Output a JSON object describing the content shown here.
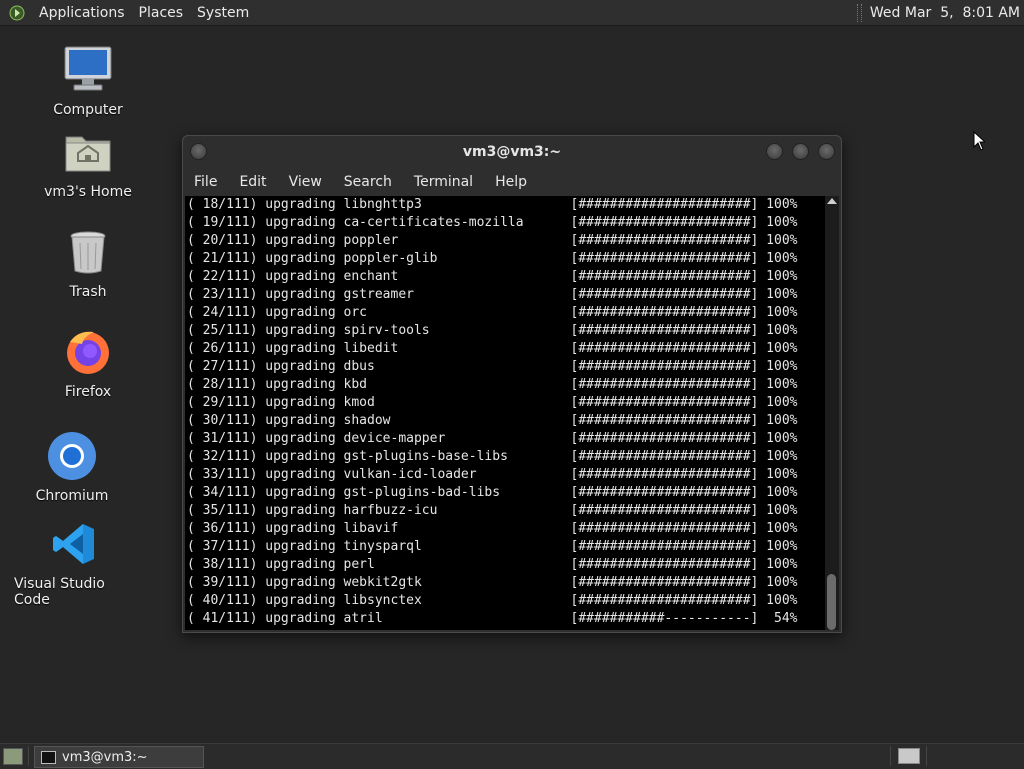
{
  "top_panel": {
    "menus": [
      "Applications",
      "Places",
      "System"
    ],
    "clock": "Wed Mar  5,  8:01 AM"
  },
  "desktop": {
    "icons": [
      {
        "label": "Computer",
        "icon": "computer-icon"
      },
      {
        "label": "vm3's Home",
        "icon": "home-folder-icon"
      },
      {
        "label": "Trash",
        "icon": "trash-icon"
      },
      {
        "label": "Firefox",
        "icon": "firefox-icon"
      },
      {
        "label": "Chromium",
        "icon": "chromium-icon"
      },
      {
        "label": "Visual Studio Code",
        "icon": "vscode-icon"
      }
    ]
  },
  "terminal": {
    "title": "vm3@vm3:~",
    "menus": [
      "File",
      "Edit",
      "View",
      "Search",
      "Terminal",
      "Help"
    ],
    "lines": [
      "( 18/111) upgrading libnghttp3                   [######################] 100%",
      "( 19/111) upgrading ca-certificates-mozilla      [######################] 100%",
      "( 20/111) upgrading poppler                      [######################] 100%",
      "( 21/111) upgrading poppler-glib                 [######################] 100%",
      "( 22/111) upgrading enchant                      [######################] 100%",
      "( 23/111) upgrading gstreamer                    [######################] 100%",
      "( 24/111) upgrading orc                          [######################] 100%",
      "( 25/111) upgrading spirv-tools                  [######################] 100%",
      "( 26/111) upgrading libedit                      [######################] 100%",
      "( 27/111) upgrading dbus                         [######################] 100%",
      "( 28/111) upgrading kbd                          [######################] 100%",
      "( 29/111) upgrading kmod                         [######################] 100%",
      "( 30/111) upgrading shadow                       [######################] 100%",
      "( 31/111) upgrading device-mapper                [######################] 100%",
      "( 32/111) upgrading gst-plugins-base-libs        [######################] 100%",
      "( 33/111) upgrading vulkan-icd-loader            [######################] 100%",
      "( 34/111) upgrading gst-plugins-bad-libs         [######################] 100%",
      "( 35/111) upgrading harfbuzz-icu                 [######################] 100%",
      "( 36/111) upgrading libavif                      [######################] 100%",
      "( 37/111) upgrading tinysparql                   [######################] 100%",
      "( 38/111) upgrading perl                         [######################] 100%",
      "( 39/111) upgrading webkit2gtk                   [######################] 100%",
      "( 40/111) upgrading libsynctex                   [######################] 100%",
      "( 41/111) upgrading atril                        [###########-----------]  54%"
    ]
  },
  "taskbar": {
    "window_label": "vm3@vm3:~"
  }
}
